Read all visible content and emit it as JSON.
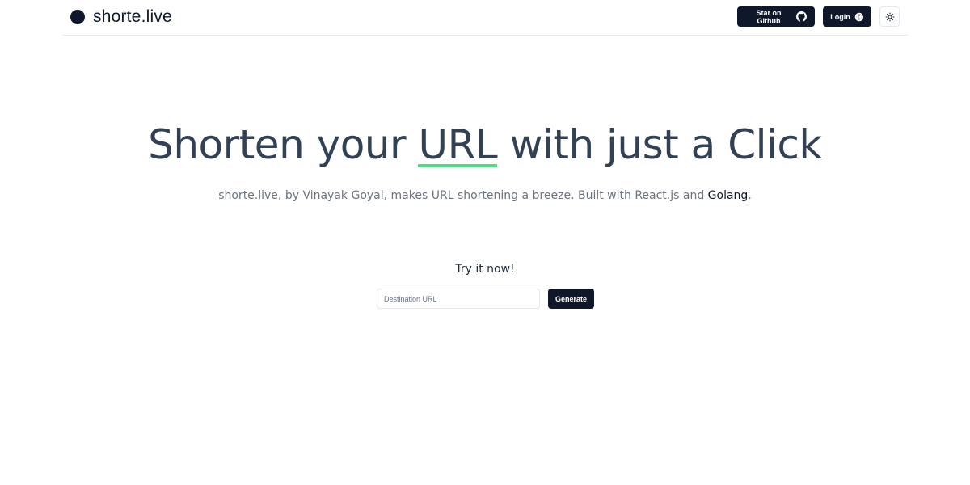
{
  "brand": {
    "name": "shorte.live"
  },
  "nav": {
    "github_label": "Star on Github",
    "login_label": "Login",
    "theme_icon": "sun-icon"
  },
  "hero": {
    "title_before": "Shorten your ",
    "title_highlight": "URL",
    "title_after": " with just a Click",
    "highlight_color": "#4ade80"
  },
  "subtitle": {
    "text_before": "shorte.live, by Vinayak Goyal, makes URL shortening a breeze. Built with React.js and ",
    "strong": "Golang",
    "text_after": "."
  },
  "form": {
    "try_label": "Try it now!",
    "input_placeholder": "Destination URL",
    "input_value": "",
    "generate_label": "Generate"
  },
  "colors": {
    "primary": "#0f172a",
    "accent": "#4ade80"
  }
}
